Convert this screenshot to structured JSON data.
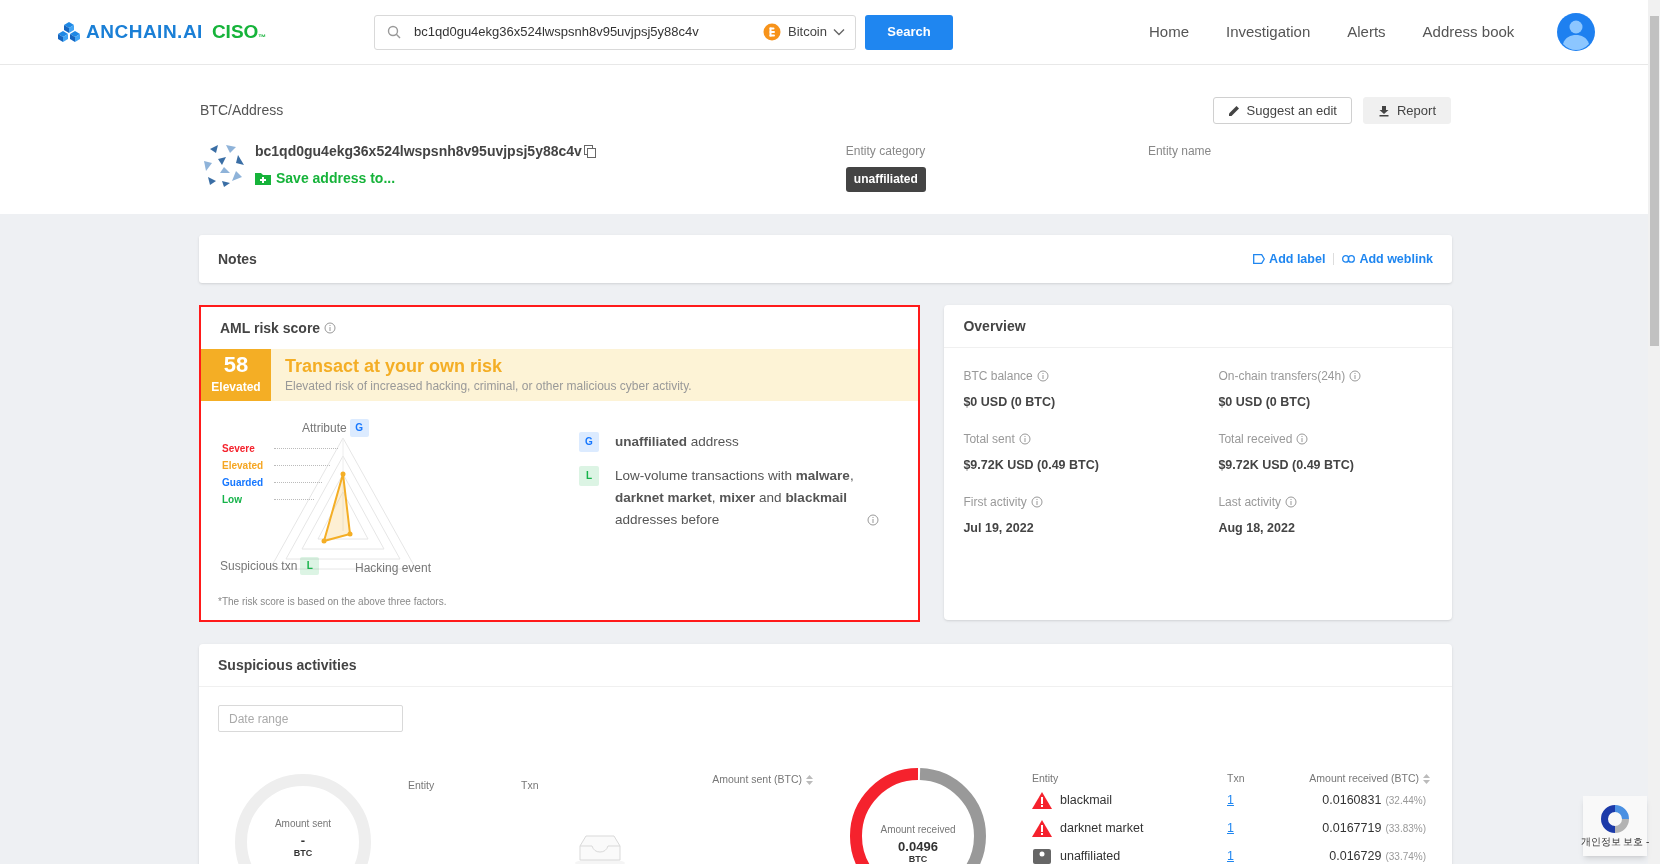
{
  "header": {
    "logo": "ANCHAIN.AI",
    "logo_suffix": "CISO",
    "trademark": "™",
    "search": {
      "value": "bc1qd0gu4ekg36x524lwspsnh8v95uvjpsj5y88c4v",
      "currency": "Bitcoin",
      "button": "Search"
    },
    "nav": [
      {
        "label": "Home"
      },
      {
        "label": "Investigation"
      },
      {
        "label": "Alerts"
      },
      {
        "label": "Address book"
      }
    ]
  },
  "address_panel": {
    "breadcrumb": "BTC/Address",
    "actions": [
      {
        "label": "Suggest an edit",
        "kind": "edit"
      },
      {
        "label": "Report",
        "kind": "download"
      }
    ],
    "address": "bc1qd0gu4ekg36x524lwspsnh8v95uvjpsj5y88c4v",
    "save_link": "Save address to...",
    "entity_category_label": "Entity category",
    "entity_category": "unaffiliated",
    "entity_name_label": "Entity name"
  },
  "notes": {
    "title": "Notes",
    "links": [
      {
        "label": "Add label",
        "kind": "label"
      },
      {
        "label": "Add weblink",
        "kind": "link"
      }
    ]
  },
  "aml": {
    "title": "AML risk score",
    "score": "58",
    "level": "Elevated",
    "headline": "Transact at your own risk",
    "description": "Elevated risk of increased hacking, criminal, or other malicious cyber activity.",
    "risk_levels": [
      {
        "label": "Severe",
        "color": "#f5222d"
      },
      {
        "label": "Elevated",
        "color": "#f5a623"
      },
      {
        "label": "Guarded",
        "color": "#1677ff"
      },
      {
        "label": "Low",
        "color": "#16b34a"
      }
    ],
    "factors": [
      {
        "label": "Attribute",
        "grade": "G",
        "color": "#1677ff"
      },
      {
        "label": "Suspicious txn",
        "grade": "L",
        "color": "#16b34a"
      },
      {
        "label": "Hacking event"
      }
    ],
    "findings": [
      {
        "grade": "G",
        "color": "#1677ff",
        "text": "**unaffiliated** address",
        "info": false
      },
      {
        "grade": "L",
        "color": "#16b34a",
        "text": "Low-volume transactions with **malware**, **darknet market**, **mixer** and **blackmail** addresses before",
        "info": true
      }
    ],
    "footnote": "*The risk score is based on the above three factors."
  },
  "overview": {
    "title": "Overview",
    "items": [
      {
        "label": "BTC balance",
        "value": "$0 USD (0 BTC)"
      },
      {
        "label": "On-chain transfers(24h)",
        "value": "$0 USD (0 BTC)"
      },
      {
        "label": "Total sent",
        "value": "$9.72K USD (0.49 BTC)"
      },
      {
        "label": "Total received",
        "value": "$9.72K USD (0.49 BTC)"
      },
      {
        "label": "First activity",
        "value": "Jul 19, 2022"
      },
      {
        "label": "Last activity",
        "value": "Aug 18, 2022"
      }
    ]
  },
  "suspicious": {
    "title": "Suspicious activities",
    "date_placeholder": "Date range",
    "sent": {
      "donut_label": "Amount sent",
      "donut_value": "-",
      "donut_unit": "BTC",
      "columns": [
        "Entity",
        "Txn",
        "Amount sent (BTC)"
      ]
    },
    "received": {
      "donut_label": "Amount received",
      "donut_value": "0.0496",
      "donut_unit": "BTC",
      "columns": [
        "Entity",
        "Txn",
        "Amount received (BTC)"
      ],
      "rows": [
        {
          "entity": "blackmail",
          "kind": "warning",
          "txn": "1",
          "amount": "0.0160831",
          "share": "(32.44%)"
        },
        {
          "entity": "darknet market",
          "kind": "warning",
          "txn": "1",
          "amount": "0.0167719",
          "share": "(33.83%)"
        },
        {
          "entity": "unaffiliated",
          "kind": "neutral",
          "txn": "1",
          "amount": "0.016729",
          "share": "(33.74%)"
        }
      ]
    }
  },
  "recaptcha": {
    "text": "개인정보 보호 -"
  }
}
